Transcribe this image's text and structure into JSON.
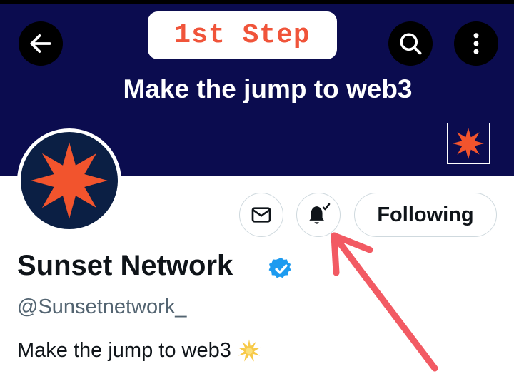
{
  "header": {
    "back_icon": "arrow-left-icon",
    "search_icon": "search-icon",
    "more_icon": "more-vertical-icon"
  },
  "annotation": {
    "step_label": "1st Step",
    "arrow_color": "#f25a63"
  },
  "banner": {
    "title": "Make the jump to web3",
    "background_color": "#0b0c4f",
    "logo_color": "#f2542d"
  },
  "profile": {
    "name": "Sunset Network",
    "handle": "@Sunsetnetwork_",
    "bio": "Make the jump to web3",
    "bio_emoji": "sparkle-star-icon",
    "verified": true,
    "verified_color": "#1d9bf0"
  },
  "actions": {
    "message_icon": "envelope-icon",
    "notify_icon": "bell-check-icon",
    "following_label": "Following"
  }
}
